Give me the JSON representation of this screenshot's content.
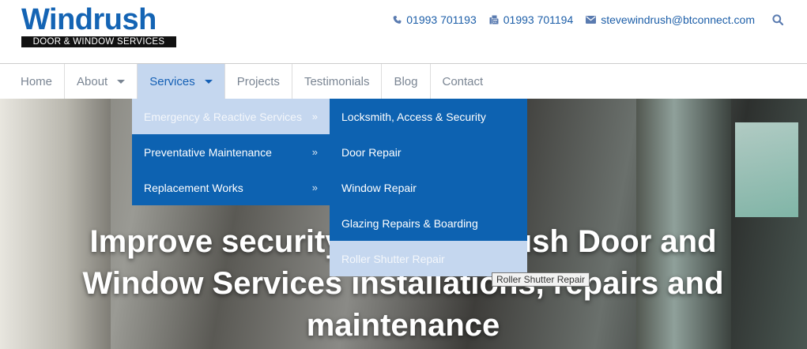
{
  "header": {
    "logo_word": "Windrush",
    "logo_tagline": "DOOR & WINDOW SERVICES",
    "phone": "01993 701193",
    "fax": "01993 701194",
    "email": "stevewindrush@btconnect.com"
  },
  "nav": [
    {
      "label": "Home"
    },
    {
      "label": "About"
    },
    {
      "label": "Services"
    },
    {
      "label": "Projects"
    },
    {
      "label": "Testimonials"
    },
    {
      "label": "Blog"
    },
    {
      "label": "Contact"
    }
  ],
  "services_menu": [
    {
      "label": "Emergency & Reactive Services",
      "arrow": "»"
    },
    {
      "label": "Preventative Maintenance",
      "arrow": "»"
    },
    {
      "label": "Replacement Works",
      "arrow": "»"
    }
  ],
  "emergency_submenu": [
    {
      "label": "Locksmith, Access & Security"
    },
    {
      "label": "Door Repair"
    },
    {
      "label": "Window Repair"
    },
    {
      "label": "Glazing Repairs & Boarding"
    },
    {
      "label": "Roller Shutter Repair"
    }
  ],
  "hero": {
    "heading": "Improve security with Windrush Door and Window Services installations, repairs and maintenance"
  },
  "tooltip": "Roller Shutter Repair",
  "colors": {
    "brand_blue": "#1464b4",
    "menu_blue": "#0d62b1",
    "highlight": "#c5d7ef"
  }
}
